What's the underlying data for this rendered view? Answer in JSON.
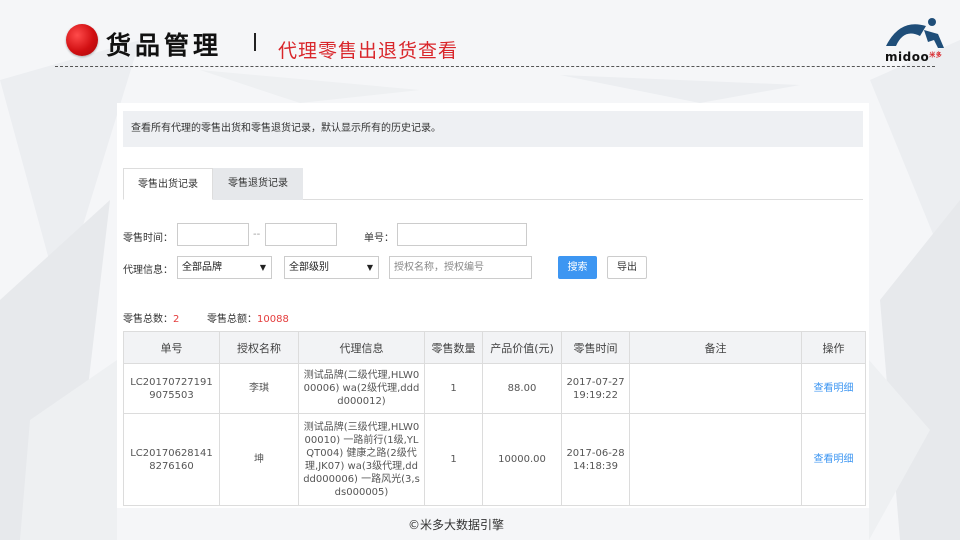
{
  "header": {
    "title": "货品管理",
    "subtitle": "代理零售出退货查看",
    "logo_text": "midoo",
    "logo_small": "米多"
  },
  "notice": "查看所有代理的零售出货和零售退货记录，默认显示所有的历史记录。",
  "tabs": [
    {
      "label": "零售出货记录",
      "active": true
    },
    {
      "label": "零售退货记录",
      "active": false
    }
  ],
  "filters": {
    "time_label": "零售时间：",
    "time_sep": "--",
    "order_label": "单号：",
    "agent_label": "代理信息：",
    "brand_select": "全部品牌",
    "level_select": "全部级别",
    "auth_placeholder": "授权名称，授权编号",
    "search_button": "搜索",
    "export_button": "导出"
  },
  "summary": {
    "count_label": "零售总数：",
    "count_value": "2",
    "amount_label": "零售总额：",
    "amount_value": "10088"
  },
  "table": {
    "columns": [
      "单号",
      "授权名称",
      "代理信息",
      "零售数量",
      "产品价值(元)",
      "零售时间",
      "备注",
      "操作"
    ],
    "rows": [
      {
        "order_no": "LC201707271919075503",
        "auth_name": "李琪",
        "agent_info": "测试品牌(二级代理,HLW000006) wa(2级代理,dddd000012)",
        "qty": "1",
        "value": "88.00",
        "time": "2017-07-27 19:19:22",
        "remark": "",
        "action": "查看明细"
      },
      {
        "order_no": "LC201706281418276160",
        "auth_name": "坤",
        "agent_info": "测试品牌(三级代理,HLW000010) 一路前行(1级,YLQT004) 健康之路(2级代理,JK07) wa(3级代理,dddd000006) 一路风光(3,sds000005)",
        "qty": "1",
        "value": "10000.00",
        "time": "2017-06-28 14:18:39",
        "remark": "",
        "action": "查看明细"
      }
    ]
  },
  "footer": "©米多大数据引擎",
  "colors": {
    "accent_red": "#d9262b",
    "primary_blue": "#3d96f2",
    "amount_red": "#e43c3c"
  }
}
